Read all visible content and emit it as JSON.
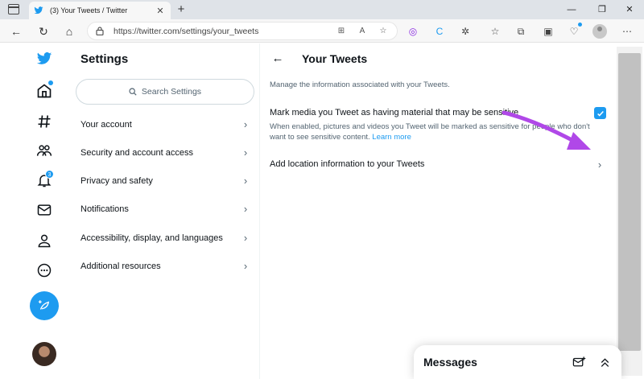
{
  "browser": {
    "tab_title": "(3) Your Tweets / Twitter",
    "new_tab": "+",
    "close_tab": "✕",
    "url": "https://twitter.com/settings/your_tweets",
    "window_controls": {
      "minimize": "—",
      "restore": "❐",
      "close": "✕"
    }
  },
  "nav": {
    "notification_badge": "3",
    "items": [
      "home-icon",
      "explore-icon",
      "communities-icon",
      "notifications-icon",
      "messages-icon",
      "profile-icon",
      "more-icon"
    ]
  },
  "settings": {
    "title": "Settings",
    "search_placeholder": "Search Settings",
    "items": [
      {
        "label": "Your account"
      },
      {
        "label": "Security and account access"
      },
      {
        "label": "Privacy and safety"
      },
      {
        "label": "Notifications"
      },
      {
        "label": "Accessibility, display, and languages"
      },
      {
        "label": "Additional resources"
      }
    ]
  },
  "detail": {
    "title": "Your Tweets",
    "intro": "Manage the information associated with your Tweets.",
    "sensitive": {
      "label": "Mark media you Tweet as having material that may be sensitive",
      "description": "When enabled, pictures and videos you Tweet will be marked as sensitive for people who don't want to see sensitive content.",
      "link": "Learn more",
      "checked": true
    },
    "location_label": "Add location information to your Tweets"
  },
  "messages": {
    "title": "Messages"
  },
  "colors": {
    "accent": "#1d9bf0",
    "annotation_arrow": "#b048e8"
  }
}
